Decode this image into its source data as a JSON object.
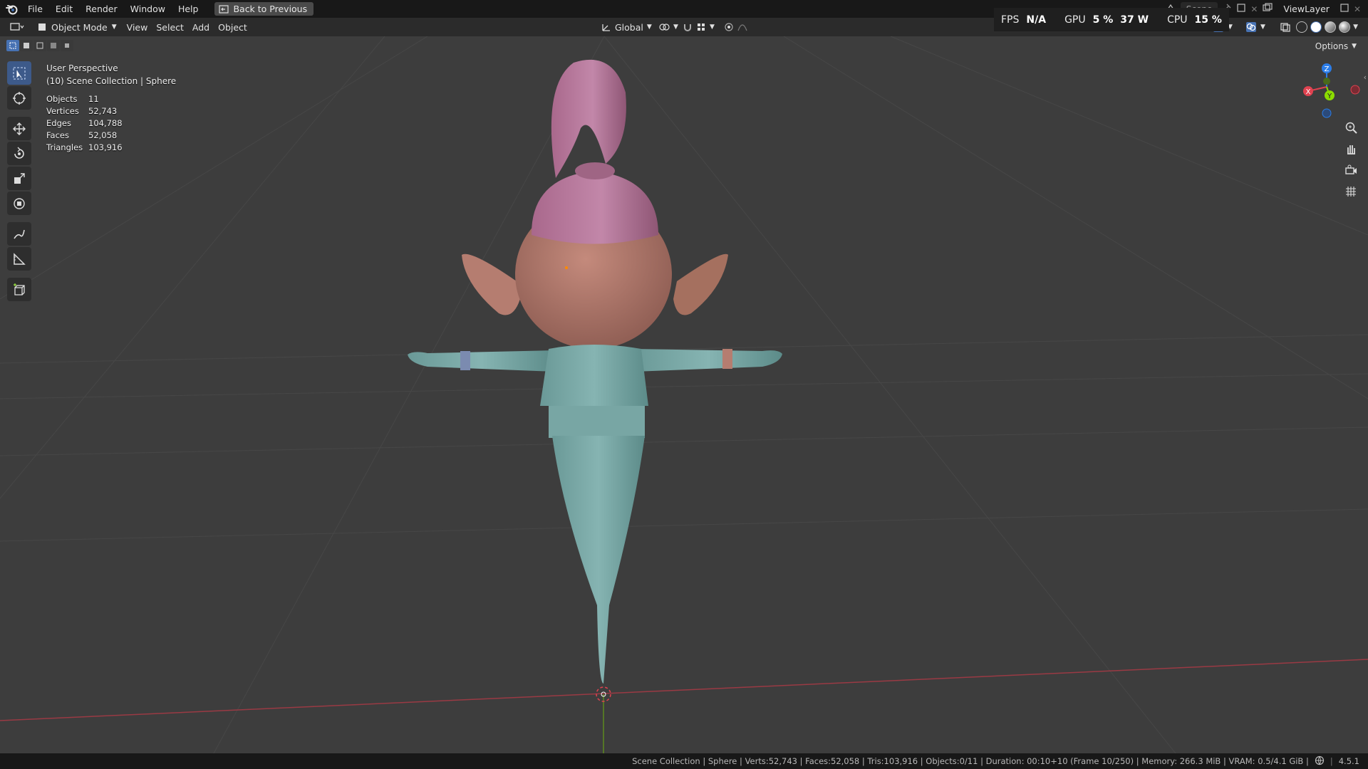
{
  "menu": {
    "items": [
      "File",
      "Edit",
      "Render",
      "Window",
      "Help"
    ],
    "back_button": "Back to Previous"
  },
  "header": {
    "mode": "Object Mode",
    "menus": [
      "View",
      "Select",
      "Add",
      "Object"
    ],
    "transform_orientation": "Global"
  },
  "perf": {
    "fps_label": "FPS",
    "fps_value": "N/A",
    "gpu_label": "GPU",
    "gpu_percent": "5 %",
    "gpu_watts": "37 W",
    "cpu_label": "CPU",
    "cpu_percent": "15 %"
  },
  "scene": {
    "scene_name": "Scene",
    "view_layer": "ViewLayer"
  },
  "viewport": {
    "perspective": "User Perspective",
    "collection": "(10) Scene Collection | Sphere",
    "options_label": "Options",
    "stats": [
      {
        "label": "Objects",
        "value": "11"
      },
      {
        "label": "Vertices",
        "value": "52,743"
      },
      {
        "label": "Edges",
        "value": "104,788"
      },
      {
        "label": "Faces",
        "value": "52,058"
      },
      {
        "label": "Triangles",
        "value": "103,916"
      }
    ],
    "gizmo_axes": {
      "x": "X",
      "y": "Y",
      "z": "Z"
    }
  },
  "colors": {
    "accent": "#4772b3",
    "x_axis": "#e04250",
    "y_axis": "#8bdc00",
    "z_axis": "#2b7de9",
    "skin": "#b57d70",
    "hair": "#b9789d",
    "shirt": "#7aa8a6"
  },
  "status": {
    "text": "Scene Collection | Sphere | Verts:52,743 | Faces:52,058 | Tris:103,916 | Objects:0/11 | Duration: 00:10+10 (Frame 10/250) | Memory: 266.3 MiB | VRAM: 0.5/4.1 GiB |",
    "version": "4.5.1"
  }
}
